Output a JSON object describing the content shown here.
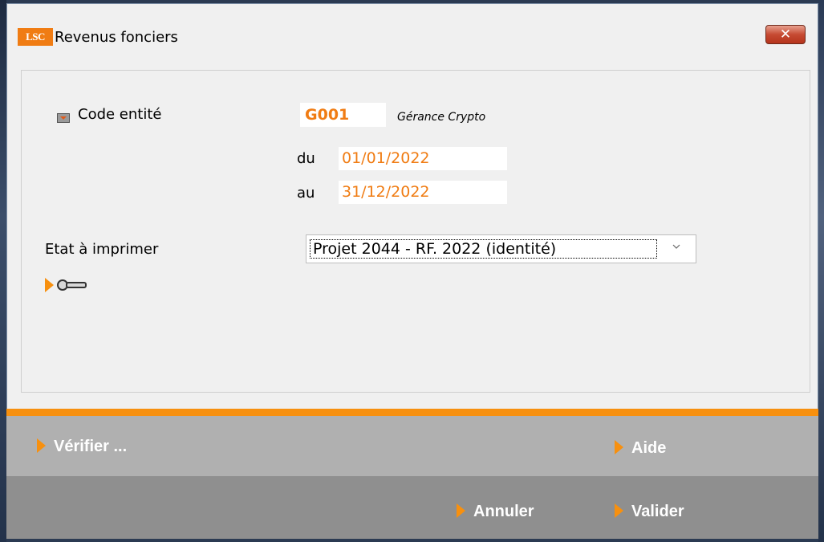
{
  "window": {
    "title": "Revenus fonciers",
    "app_logo": "LSC",
    "close_symbol": "✕"
  },
  "form": {
    "code_entite_label": "Code entité",
    "code_entite_value": "G001",
    "entity_name": "Gérance Crypto",
    "du_label": "du",
    "du_value": "01/01/2022",
    "au_label": "au",
    "au_value": "31/12/2022",
    "etat_label": "Etat à imprimer",
    "etat_selected": "Projet 2044 - RF. 2022 (identité)"
  },
  "buttons": {
    "verifier": "Vérifier ...",
    "aide": "Aide",
    "annuler": "Annuler",
    "valider": "Valider"
  },
  "colors": {
    "accent": "#f7900f",
    "value_orange": "#f07c13",
    "close_red": "#c64a32"
  }
}
